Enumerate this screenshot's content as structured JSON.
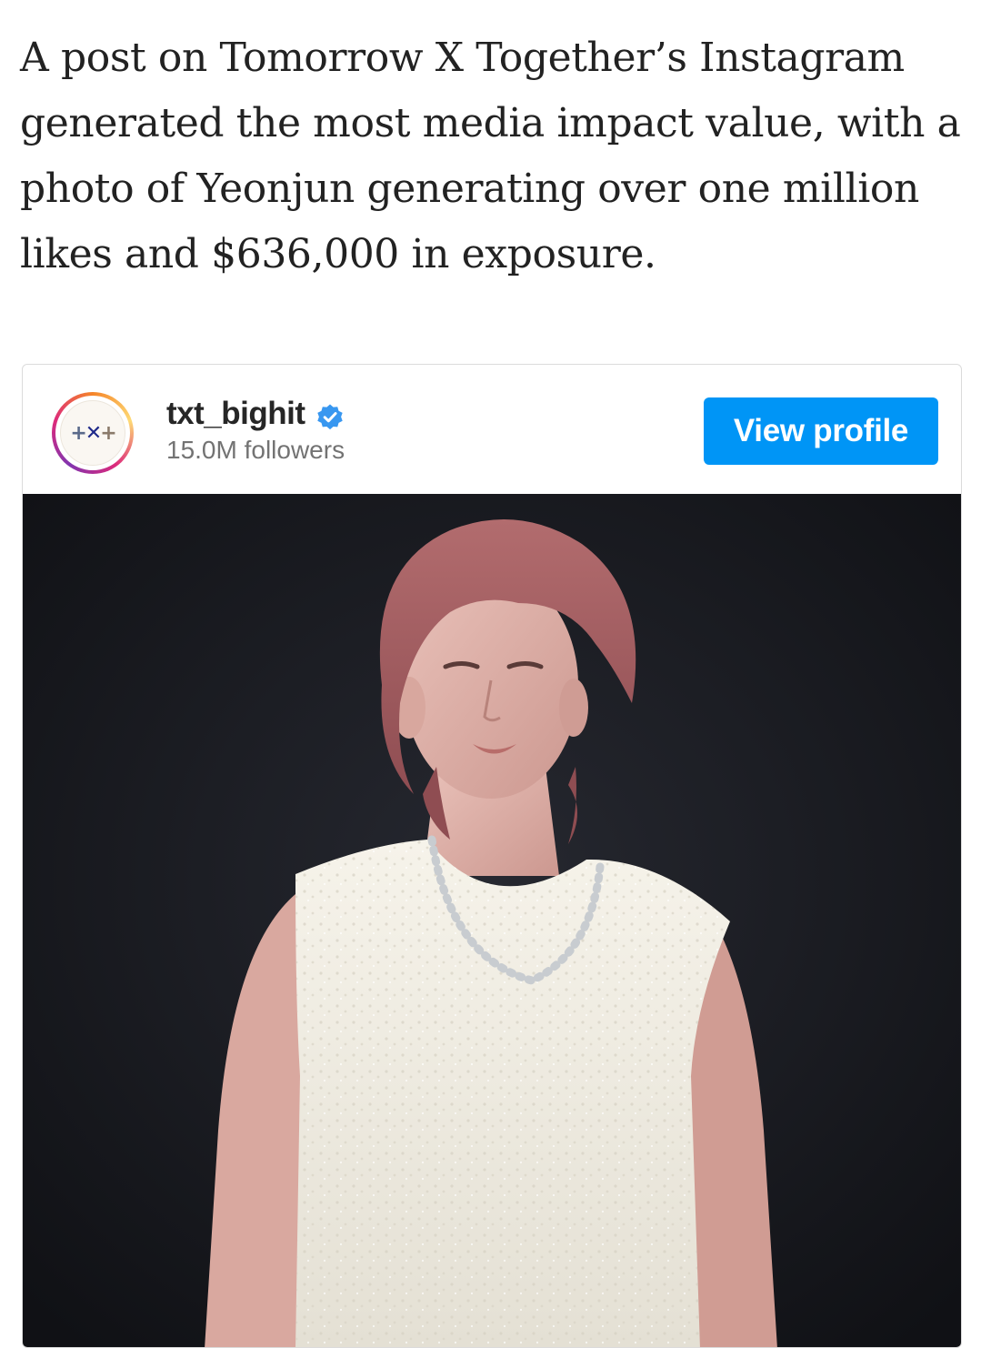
{
  "article": {
    "text": "A post on Tomorrow X Together’s Instagram generated the most media impact value, with a photo of Yeonjun generating over one million likes and $636,000 in exposure."
  },
  "embed": {
    "username": "txt_bighit",
    "followers": "15.0M followers",
    "view_profile_label": "View profile",
    "verified_icon": "verified-badge-icon",
    "colors": {
      "button": "#0095f6",
      "verified": "#3897f0",
      "photo_background": "#16171b",
      "top": "#f2efe6"
    }
  }
}
